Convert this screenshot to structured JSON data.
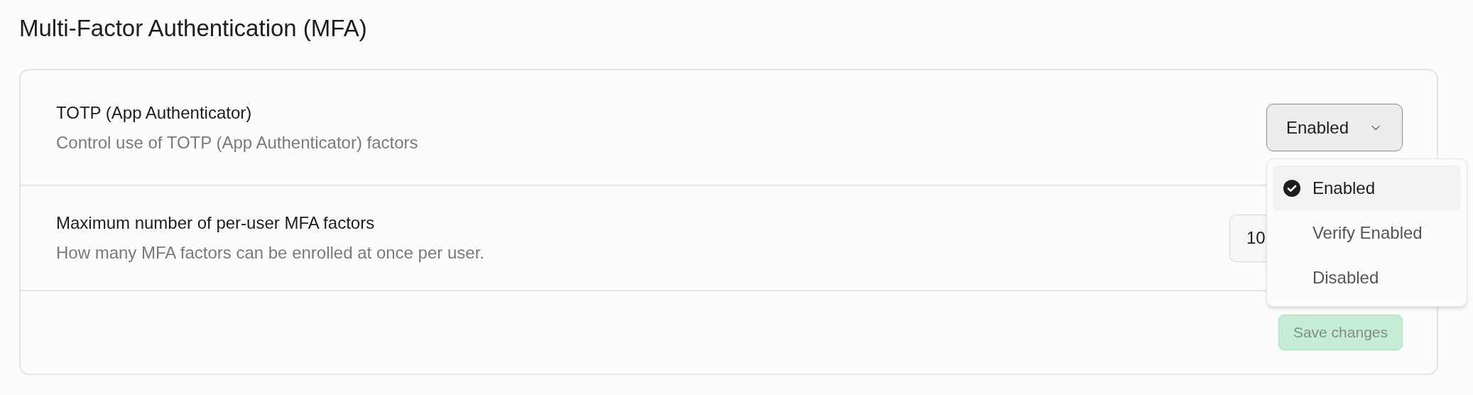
{
  "page": {
    "title": "Multi-Factor Authentication (MFA)"
  },
  "settings": [
    {
      "kind": "select",
      "label": "TOTP (App Authenticator)",
      "description": "Control use of TOTP (App Authenticator) factors",
      "value": "Enabled",
      "expanded": true,
      "options": [
        {
          "label": "Enabled",
          "selected": true
        },
        {
          "label": "Verify Enabled",
          "selected": false
        },
        {
          "label": "Disabled",
          "selected": false
        }
      ]
    },
    {
      "kind": "number",
      "label": "Maximum number of per-user MFA factors",
      "description": "How many MFA factors can be enrolled at once per user.",
      "value": "10"
    }
  ],
  "save_button": {
    "label": "Save changes",
    "disabled": true
  }
}
